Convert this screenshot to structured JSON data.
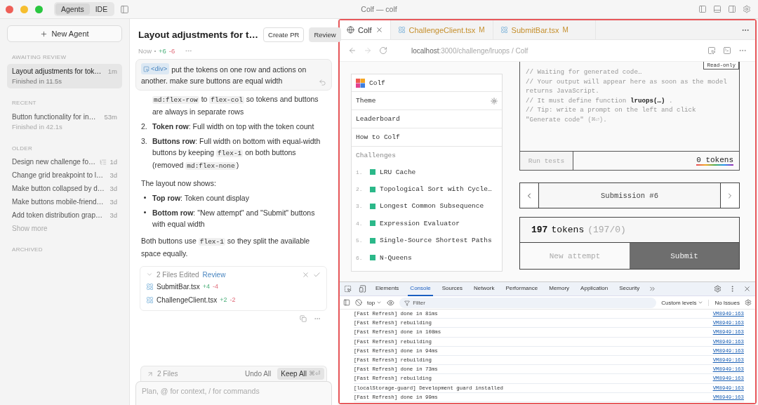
{
  "titlebar": {
    "title": "Colf — colf",
    "modes": [
      {
        "label": "Agents",
        "selected": true
      },
      {
        "label": "IDE",
        "selected": false
      }
    ]
  },
  "sidebar": {
    "new_agent": "New Agent",
    "sections": [
      {
        "heading": "AWAITING REVIEW",
        "items": [
          {
            "title": "Layout adjustments for tok…",
            "time": "1m",
            "status": "Finished in 11.5s",
            "selected": true,
            "has_plan": false
          }
        ]
      },
      {
        "heading": "RECENT",
        "items": [
          {
            "title": "Button functionality for in…",
            "time": "53m",
            "status": "Finished in 42.1s",
            "selected": false,
            "has_plan": false
          }
        ]
      },
      {
        "heading": "OLDER",
        "items": [
          {
            "title": "Design new challenge fo…",
            "time": "1d",
            "selected": false,
            "has_plan": true
          },
          {
            "title": "Change grid breakpoint to l…",
            "time": "3d",
            "selected": false,
            "has_plan": false
          },
          {
            "title": "Make button collapsed by d…",
            "time": "3d",
            "selected": false,
            "has_plan": false
          },
          {
            "title": "Make buttons mobile-friend…",
            "time": "3d",
            "selected": false,
            "has_plan": false
          },
          {
            "title": "Add token distribution grap…",
            "time": "3d",
            "selected": false,
            "has_plan": false
          }
        ],
        "more": "Show more"
      },
      {
        "heading": "ARCHIVED"
      }
    ]
  },
  "chat": {
    "title": "Layout adjustments for t…",
    "actions": [
      {
        "label": "Create PR",
        "kind": "outline"
      },
      {
        "label": "Review",
        "kind": "filled"
      }
    ],
    "meta": {
      "time": "Now",
      "added": "+6",
      "removed": "-6"
    },
    "prompt": {
      "chip": "<div>",
      "text": "put the tokens on one row and actions on another. make sure buttons are equal width"
    },
    "blocks": [
      {
        "kind": "continuation",
        "parts": [
          {
            "kind": "code",
            "text": "md:flex-row"
          },
          {
            "kind": "text",
            "text": " to "
          },
          {
            "kind": "code",
            "text": "flex-col"
          },
          {
            "kind": "text",
            "text": " so tokens and buttons are always in separate rows"
          }
        ]
      },
      {
        "kind": "ordered",
        "number": "2.",
        "parts": [
          {
            "kind": "bold",
            "text": "Token row"
          },
          {
            "kind": "text",
            "text": ": Full width on top with the token count"
          }
        ]
      },
      {
        "kind": "ordered",
        "number": "3.",
        "parts": [
          {
            "kind": "bold",
            "text": "Buttons row"
          },
          {
            "kind": "text",
            "text": ": Full width on bottom with equal-width buttons by keeping "
          },
          {
            "kind": "code",
            "text": "flex-1"
          },
          {
            "kind": "text",
            "text": " on both buttons (removed "
          },
          {
            "kind": "code",
            "text": "md:flex-none"
          },
          {
            "kind": "text",
            "text": ")"
          }
        ]
      },
      {
        "kind": "paragraph",
        "parts": [
          {
            "kind": "text",
            "text": "The layout now shows:"
          }
        ]
      },
      {
        "kind": "bullet",
        "parts": [
          {
            "kind": "bold",
            "text": "Top row"
          },
          {
            "kind": "text",
            "text": ": Token count display"
          }
        ]
      },
      {
        "kind": "bullet",
        "parts": [
          {
            "kind": "bold",
            "text": "Bottom row"
          },
          {
            "kind": "text",
            "text": ": \"New attempt\" and \"Submit\" buttons with equal width"
          }
        ]
      },
      {
        "kind": "paragraph",
        "parts": [
          {
            "kind": "text",
            "text": "Both buttons use "
          },
          {
            "kind": "code",
            "text": "flex-1"
          },
          {
            "kind": "text",
            "text": " so they split the available space equally."
          }
        ]
      }
    ],
    "edits": {
      "title": "2 Files Edited",
      "review": "Review",
      "expanded": true,
      "files": [
        {
          "name": "SubmitBar.tsx",
          "added": "+4",
          "removed": "-4"
        },
        {
          "name": "ChallengeClient.tsx",
          "added": "+2",
          "removed": "-2"
        }
      ]
    },
    "composer": {
      "files": "2 Files",
      "undo": "Undo All",
      "keep": "Keep All",
      "keep_shortcut": "⌘⏎",
      "placeholder": "Plan, @ for context, / for commands"
    }
  },
  "browser": {
    "tabs": [
      {
        "label": "Colf",
        "kind": "page",
        "selected": true
      },
      {
        "label": "ChallengeClient.tsx",
        "kind": "file",
        "badge": "M",
        "selected": false
      },
      {
        "label": "SubmitBar.tsx",
        "kind": "file",
        "badge": "M",
        "selected": false
      }
    ],
    "url": {
      "host": "localhost",
      "path": ":3000/challenge/lruops / Colf"
    },
    "nav": {
      "brand": "Colf",
      "items": [
        {
          "label": "Theme",
          "kind": "theme"
        },
        {
          "label": "Leaderboard",
          "kind": "link"
        },
        {
          "label": "How to Colf",
          "kind": "link"
        }
      ],
      "challenges_heading": "Challenges",
      "challenges": [
        {
          "number": "1.",
          "title": "LRU Cache",
          "color": "#2bb889"
        },
        {
          "number": "2.",
          "title": "Topological Sort with Cycle…",
          "color": "#2bb889"
        },
        {
          "number": "3.",
          "title": "Longest Common Subsequence",
          "color": "#2bb889"
        },
        {
          "number": "4.",
          "title": "Expression Evaluator",
          "color": "#2bb889"
        },
        {
          "number": "5.",
          "title": "Single-Source Shortest Paths",
          "color": "#2bb889"
        },
        {
          "number": "6.",
          "title": "N-Queens",
          "color": "#2bb889"
        }
      ]
    },
    "editor": {
      "badge": "Read-only",
      "lines": [
        [
          {
            "kind": "text",
            "text": "// Waiting for generated code…"
          }
        ],
        [
          {
            "kind": "text",
            "text": "// Your output will appear here as soon as the model returns JavaScript."
          }
        ],
        [
          {
            "kind": "text",
            "text": "// It must define function "
          },
          {
            "kind": "bold",
            "text": "lruops(…)"
          },
          {
            "kind": "text",
            "text": " ."
          }
        ],
        [
          {
            "kind": "text",
            "text": "// Tip: write a prompt on the left and click \"Generate code\" "
          },
          {
            "kind": "faint",
            "text": "(⌘⏎)"
          },
          {
            "kind": "text",
            "text": "."
          }
        ]
      ],
      "run": "Run tests",
      "tokens": "0 tokens"
    },
    "submission": "Submission #6",
    "score": {
      "count": "197",
      "unit": "tokens",
      "detail": "(197/0)"
    },
    "buttons": [
      {
        "label": "New attempt",
        "kind": "secondary"
      },
      {
        "label": "Submit",
        "kind": "primary"
      }
    ]
  },
  "devtools": {
    "tabs": [
      {
        "label": "Elements",
        "selected": false
      },
      {
        "label": "Console",
        "selected": true
      },
      {
        "label": "Sources",
        "selected": false
      },
      {
        "label": "Network",
        "selected": false
      },
      {
        "label": "Performance",
        "selected": false
      },
      {
        "label": "Memory",
        "selected": false
      },
      {
        "label": "Application",
        "selected": false
      },
      {
        "label": "Security",
        "selected": false
      }
    ],
    "context": "top",
    "filter_placeholder": "Filter",
    "levels": "Custom levels",
    "issues": "No Issues",
    "logs": [
      {
        "message": "[Fast Refresh] done in 81ms",
        "source": "VM8949:163"
      },
      {
        "message": "[Fast Refresh] rebuilding",
        "source": "VM8949:163"
      },
      {
        "message": "[Fast Refresh] done in 108ms",
        "source": "VM8949:163"
      },
      {
        "message": "[Fast Refresh] rebuilding",
        "source": "VM8949:163"
      },
      {
        "message": "[Fast Refresh] done in 94ms",
        "source": "VM8949:163"
      },
      {
        "message": "[Fast Refresh] rebuilding",
        "source": "VM8949:163"
      },
      {
        "message": "[Fast Refresh] done in 73ms",
        "source": "VM8949:163"
      },
      {
        "message": "[Fast Refresh] rebuilding",
        "source": "VM8949:163"
      },
      {
        "message": "[localStorage-guard] Development guard installed",
        "source": "VM8949:163"
      },
      {
        "message": "[Fast Refresh] done in 99ms",
        "source": "VM8949:163"
      }
    ]
  }
}
